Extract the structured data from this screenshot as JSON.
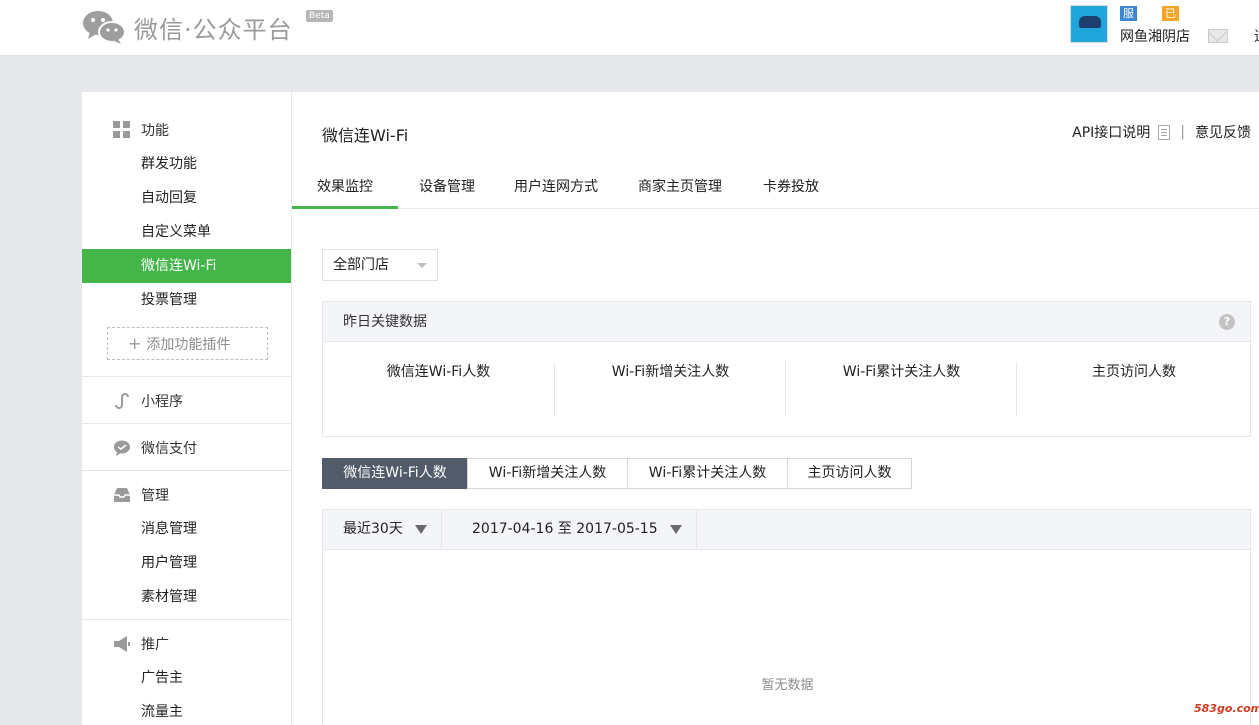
{
  "header": {
    "logo_text": "微信·公众平台",
    "beta": "Beta",
    "account": {
      "badge_service": "服务号",
      "badge_verified": "已认证",
      "shop_name": "网鱼湘阴店",
      "cut_text": "退"
    }
  },
  "sidebar": {
    "function_title": "功能",
    "function_items": [
      "群发功能",
      "自动回复",
      "自定义菜单",
      "微信连Wi-Fi",
      "投票管理"
    ],
    "add_plugin": "添加功能插件",
    "mini_program": "小程序",
    "wechat_pay": "微信支付",
    "manage_title": "管理",
    "manage_items": [
      "消息管理",
      "用户管理",
      "素材管理"
    ],
    "promo_title": "推广",
    "promo_items": [
      "广告主",
      "流量主"
    ]
  },
  "main": {
    "title": "微信连Wi-Fi",
    "links": {
      "api": "API接口说明",
      "sep": "|",
      "feedback": "意见反馈"
    },
    "tabs": [
      "效果监控",
      "设备管理",
      "用户连网方式",
      "商家主页管理",
      "卡券投放"
    ],
    "store_select": "全部门店",
    "key_data_title": "昨日关键数据",
    "help": "?",
    "metrics": [
      "微信连Wi-Fi人数",
      "Wi-Fi新增关注人数",
      "Wi-Fi累计关注人数",
      "主页访问人数"
    ],
    "segments": [
      "微信连Wi-Fi人数",
      "Wi-Fi新增关注人数",
      "Wi-Fi累计关注人数",
      "主页访问人数"
    ],
    "range_select": "最近30天",
    "date_range": "2017-04-16 至 2017-05-15",
    "empty_text": "暂无数据"
  },
  "watermark": "583go.com",
  "colors": {
    "accent": "#44b549",
    "active_segment": "#525b69"
  }
}
